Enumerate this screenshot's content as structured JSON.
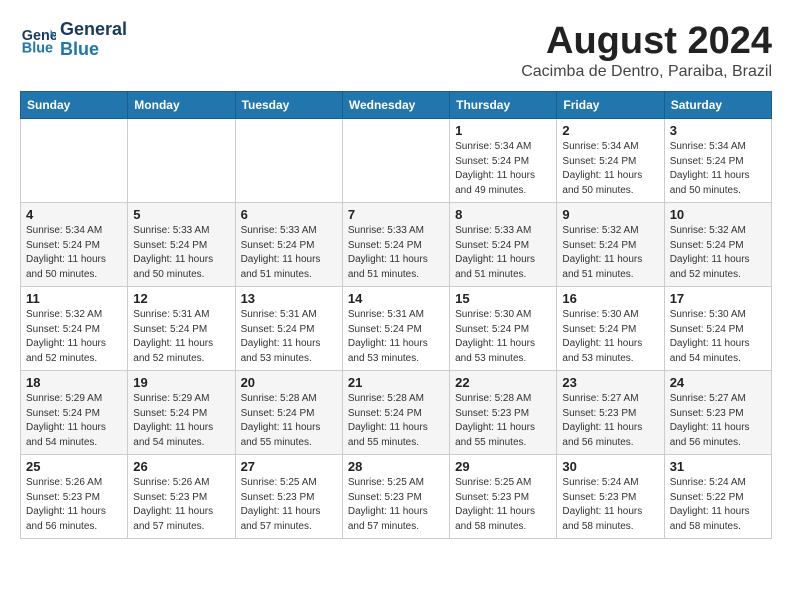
{
  "header": {
    "logo_line1": "General",
    "logo_line2": "Blue",
    "title": "August 2024",
    "subtitle": "Cacimba de Dentro, Paraiba, Brazil"
  },
  "days_of_week": [
    "Sunday",
    "Monday",
    "Tuesday",
    "Wednesday",
    "Thursday",
    "Friday",
    "Saturday"
  ],
  "weeks": [
    [
      {
        "day": "",
        "detail": ""
      },
      {
        "day": "",
        "detail": ""
      },
      {
        "day": "",
        "detail": ""
      },
      {
        "day": "",
        "detail": ""
      },
      {
        "day": "1",
        "detail": "Sunrise: 5:34 AM\nSunset: 5:24 PM\nDaylight: 11 hours\nand 49 minutes."
      },
      {
        "day": "2",
        "detail": "Sunrise: 5:34 AM\nSunset: 5:24 PM\nDaylight: 11 hours\nand 50 minutes."
      },
      {
        "day": "3",
        "detail": "Sunrise: 5:34 AM\nSunset: 5:24 PM\nDaylight: 11 hours\nand 50 minutes."
      }
    ],
    [
      {
        "day": "4",
        "detail": "Sunrise: 5:34 AM\nSunset: 5:24 PM\nDaylight: 11 hours\nand 50 minutes."
      },
      {
        "day": "5",
        "detail": "Sunrise: 5:33 AM\nSunset: 5:24 PM\nDaylight: 11 hours\nand 50 minutes."
      },
      {
        "day": "6",
        "detail": "Sunrise: 5:33 AM\nSunset: 5:24 PM\nDaylight: 11 hours\nand 51 minutes."
      },
      {
        "day": "7",
        "detail": "Sunrise: 5:33 AM\nSunset: 5:24 PM\nDaylight: 11 hours\nand 51 minutes."
      },
      {
        "day": "8",
        "detail": "Sunrise: 5:33 AM\nSunset: 5:24 PM\nDaylight: 11 hours\nand 51 minutes."
      },
      {
        "day": "9",
        "detail": "Sunrise: 5:32 AM\nSunset: 5:24 PM\nDaylight: 11 hours\nand 51 minutes."
      },
      {
        "day": "10",
        "detail": "Sunrise: 5:32 AM\nSunset: 5:24 PM\nDaylight: 11 hours\nand 52 minutes."
      }
    ],
    [
      {
        "day": "11",
        "detail": "Sunrise: 5:32 AM\nSunset: 5:24 PM\nDaylight: 11 hours\nand 52 minutes."
      },
      {
        "day": "12",
        "detail": "Sunrise: 5:31 AM\nSunset: 5:24 PM\nDaylight: 11 hours\nand 52 minutes."
      },
      {
        "day": "13",
        "detail": "Sunrise: 5:31 AM\nSunset: 5:24 PM\nDaylight: 11 hours\nand 53 minutes."
      },
      {
        "day": "14",
        "detail": "Sunrise: 5:31 AM\nSunset: 5:24 PM\nDaylight: 11 hours\nand 53 minutes."
      },
      {
        "day": "15",
        "detail": "Sunrise: 5:30 AM\nSunset: 5:24 PM\nDaylight: 11 hours\nand 53 minutes."
      },
      {
        "day": "16",
        "detail": "Sunrise: 5:30 AM\nSunset: 5:24 PM\nDaylight: 11 hours\nand 53 minutes."
      },
      {
        "day": "17",
        "detail": "Sunrise: 5:30 AM\nSunset: 5:24 PM\nDaylight: 11 hours\nand 54 minutes."
      }
    ],
    [
      {
        "day": "18",
        "detail": "Sunrise: 5:29 AM\nSunset: 5:24 PM\nDaylight: 11 hours\nand 54 minutes."
      },
      {
        "day": "19",
        "detail": "Sunrise: 5:29 AM\nSunset: 5:24 PM\nDaylight: 11 hours\nand 54 minutes."
      },
      {
        "day": "20",
        "detail": "Sunrise: 5:28 AM\nSunset: 5:24 PM\nDaylight: 11 hours\nand 55 minutes."
      },
      {
        "day": "21",
        "detail": "Sunrise: 5:28 AM\nSunset: 5:24 PM\nDaylight: 11 hours\nand 55 minutes."
      },
      {
        "day": "22",
        "detail": "Sunrise: 5:28 AM\nSunset: 5:23 PM\nDaylight: 11 hours\nand 55 minutes."
      },
      {
        "day": "23",
        "detail": "Sunrise: 5:27 AM\nSunset: 5:23 PM\nDaylight: 11 hours\nand 56 minutes."
      },
      {
        "day": "24",
        "detail": "Sunrise: 5:27 AM\nSunset: 5:23 PM\nDaylight: 11 hours\nand 56 minutes."
      }
    ],
    [
      {
        "day": "25",
        "detail": "Sunrise: 5:26 AM\nSunset: 5:23 PM\nDaylight: 11 hours\nand 56 minutes."
      },
      {
        "day": "26",
        "detail": "Sunrise: 5:26 AM\nSunset: 5:23 PM\nDaylight: 11 hours\nand 57 minutes."
      },
      {
        "day": "27",
        "detail": "Sunrise: 5:25 AM\nSunset: 5:23 PM\nDaylight: 11 hours\nand 57 minutes."
      },
      {
        "day": "28",
        "detail": "Sunrise: 5:25 AM\nSunset: 5:23 PM\nDaylight: 11 hours\nand 57 minutes."
      },
      {
        "day": "29",
        "detail": "Sunrise: 5:25 AM\nSunset: 5:23 PM\nDaylight: 11 hours\nand 58 minutes."
      },
      {
        "day": "30",
        "detail": "Sunrise: 5:24 AM\nSunset: 5:23 PM\nDaylight: 11 hours\nand 58 minutes."
      },
      {
        "day": "31",
        "detail": "Sunrise: 5:24 AM\nSunset: 5:22 PM\nDaylight: 11 hours\nand 58 minutes."
      }
    ]
  ]
}
